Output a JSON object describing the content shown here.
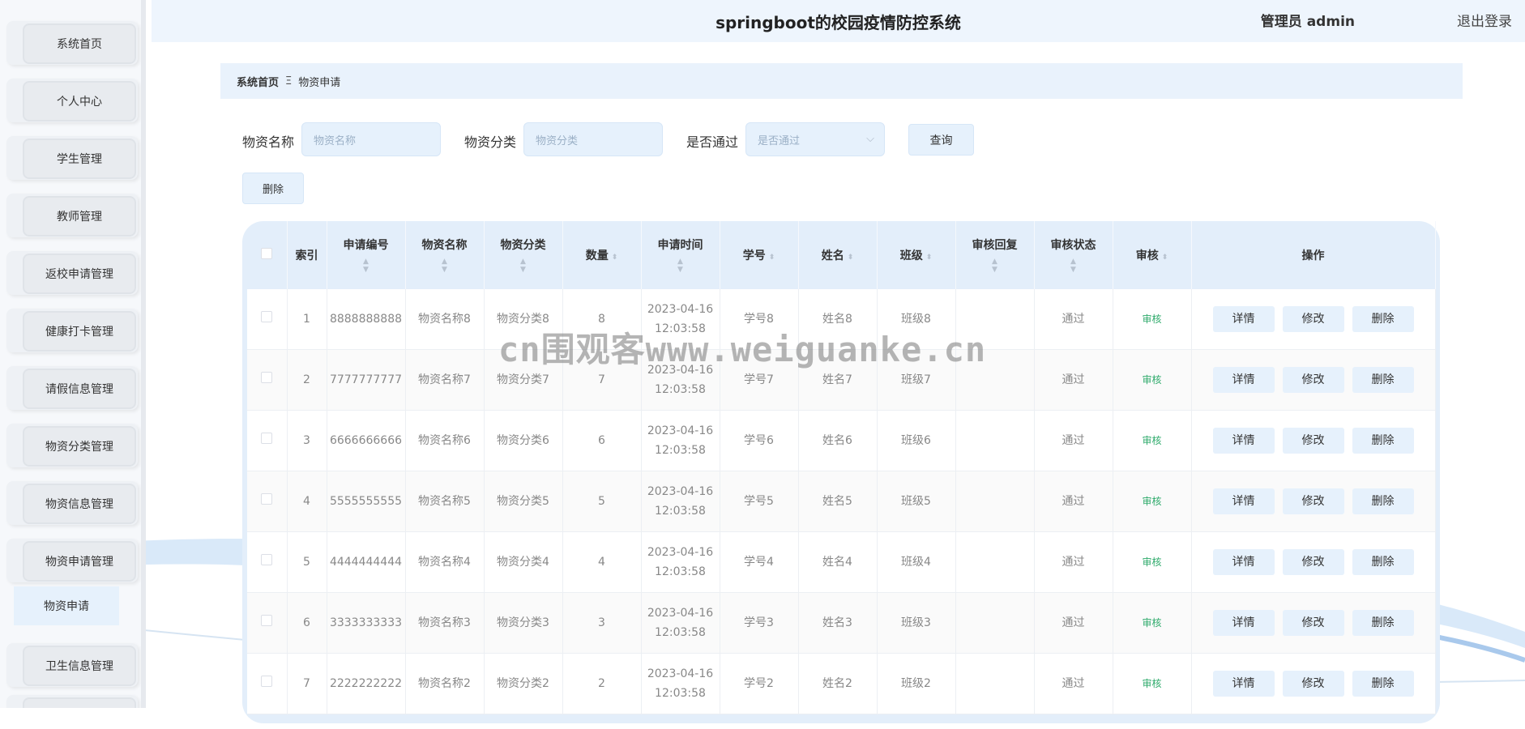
{
  "header": {
    "title": "springboot的校园疫情防控系统",
    "user": "管理员 admin",
    "logout": "退出登录"
  },
  "sidebar": {
    "items": [
      {
        "label": "系统首页"
      },
      {
        "label": "个人中心"
      },
      {
        "label": "学生管理"
      },
      {
        "label": "教师管理"
      },
      {
        "label": "返校申请管理"
      },
      {
        "label": "健康打卡管理"
      },
      {
        "label": "请假信息管理"
      },
      {
        "label": "物资分类管理"
      },
      {
        "label": "物资信息管理"
      },
      {
        "label": "物资申请管理"
      },
      {
        "label": "卫生信息管理"
      }
    ],
    "sub_item": "物资申请"
  },
  "breadcrumb": {
    "home": "系统首页",
    "separator": "Ξ",
    "current": "物资申请"
  },
  "search": {
    "name_label": "物资名称",
    "name_placeholder": "物资名称",
    "category_label": "物资分类",
    "category_placeholder": "物资分类",
    "pass_label": "是否通过",
    "pass_placeholder": "是否通过",
    "query_button": "查询",
    "delete_button": "删除"
  },
  "table": {
    "headers": {
      "index": "索引",
      "apply_no": "申请编号",
      "name": "物资名称",
      "category": "物资分类",
      "quantity": "数量",
      "apply_time": "申请时间",
      "student_no": "学号",
      "student_name": "姓名",
      "class": "班级",
      "reply": "审核回复",
      "status": "审核状态",
      "audit": "审核",
      "ops": "操作"
    },
    "ops": {
      "detail": "详情",
      "edit": "修改",
      "delete": "删除"
    },
    "rows": [
      {
        "index": "1",
        "apply_no": "8888888888",
        "name": "物资名称8",
        "category": "物资分类8",
        "quantity": "8",
        "apply_time": "2023-04-16 12:03:58",
        "student_no": "学号8",
        "student_name": "姓名8",
        "class": "班级8",
        "reply": "",
        "status": "通过",
        "audit": "审核"
      },
      {
        "index": "2",
        "apply_no": "7777777777",
        "name": "物资名称7",
        "category": "物资分类7",
        "quantity": "7",
        "apply_time": "2023-04-16 12:03:58",
        "student_no": "学号7",
        "student_name": "姓名7",
        "class": "班级7",
        "reply": "",
        "status": "通过",
        "audit": "审核"
      },
      {
        "index": "3",
        "apply_no": "6666666666",
        "name": "物资名称6",
        "category": "物资分类6",
        "quantity": "6",
        "apply_time": "2023-04-16 12:03:58",
        "student_no": "学号6",
        "student_name": "姓名6",
        "class": "班级6",
        "reply": "",
        "status": "通过",
        "audit": "审核"
      },
      {
        "index": "4",
        "apply_no": "5555555555",
        "name": "物资名称5",
        "category": "物资分类5",
        "quantity": "5",
        "apply_time": "2023-04-16 12:03:58",
        "student_no": "学号5",
        "student_name": "姓名5",
        "class": "班级5",
        "reply": "",
        "status": "通过",
        "audit": "审核"
      },
      {
        "index": "5",
        "apply_no": "4444444444",
        "name": "物资名称4",
        "category": "物资分类4",
        "quantity": "4",
        "apply_time": "2023-04-16 12:03:58",
        "student_no": "学号4",
        "student_name": "姓名4",
        "class": "班级4",
        "reply": "",
        "status": "通过",
        "audit": "审核"
      },
      {
        "index": "6",
        "apply_no": "3333333333",
        "name": "物资名称3",
        "category": "物资分类3",
        "quantity": "3",
        "apply_time": "2023-04-16 12:03:58",
        "student_no": "学号3",
        "student_name": "姓名3",
        "class": "班级3",
        "reply": "",
        "status": "通过",
        "audit": "审核"
      },
      {
        "index": "7",
        "apply_no": "2222222222",
        "name": "物资名称2",
        "category": "物资分类2",
        "quantity": "2",
        "apply_time": "2023-04-16 12:03:58",
        "student_no": "学号2",
        "student_name": "姓名2",
        "class": "班级2",
        "reply": "",
        "status": "通过",
        "audit": "审核"
      }
    ]
  },
  "watermark": "cn围观客www.weiguanke.cn",
  "colors": {
    "accent": "#e6f1fc",
    "audit_green": "#2eaa6b",
    "header_bg": "#eef5fd"
  }
}
